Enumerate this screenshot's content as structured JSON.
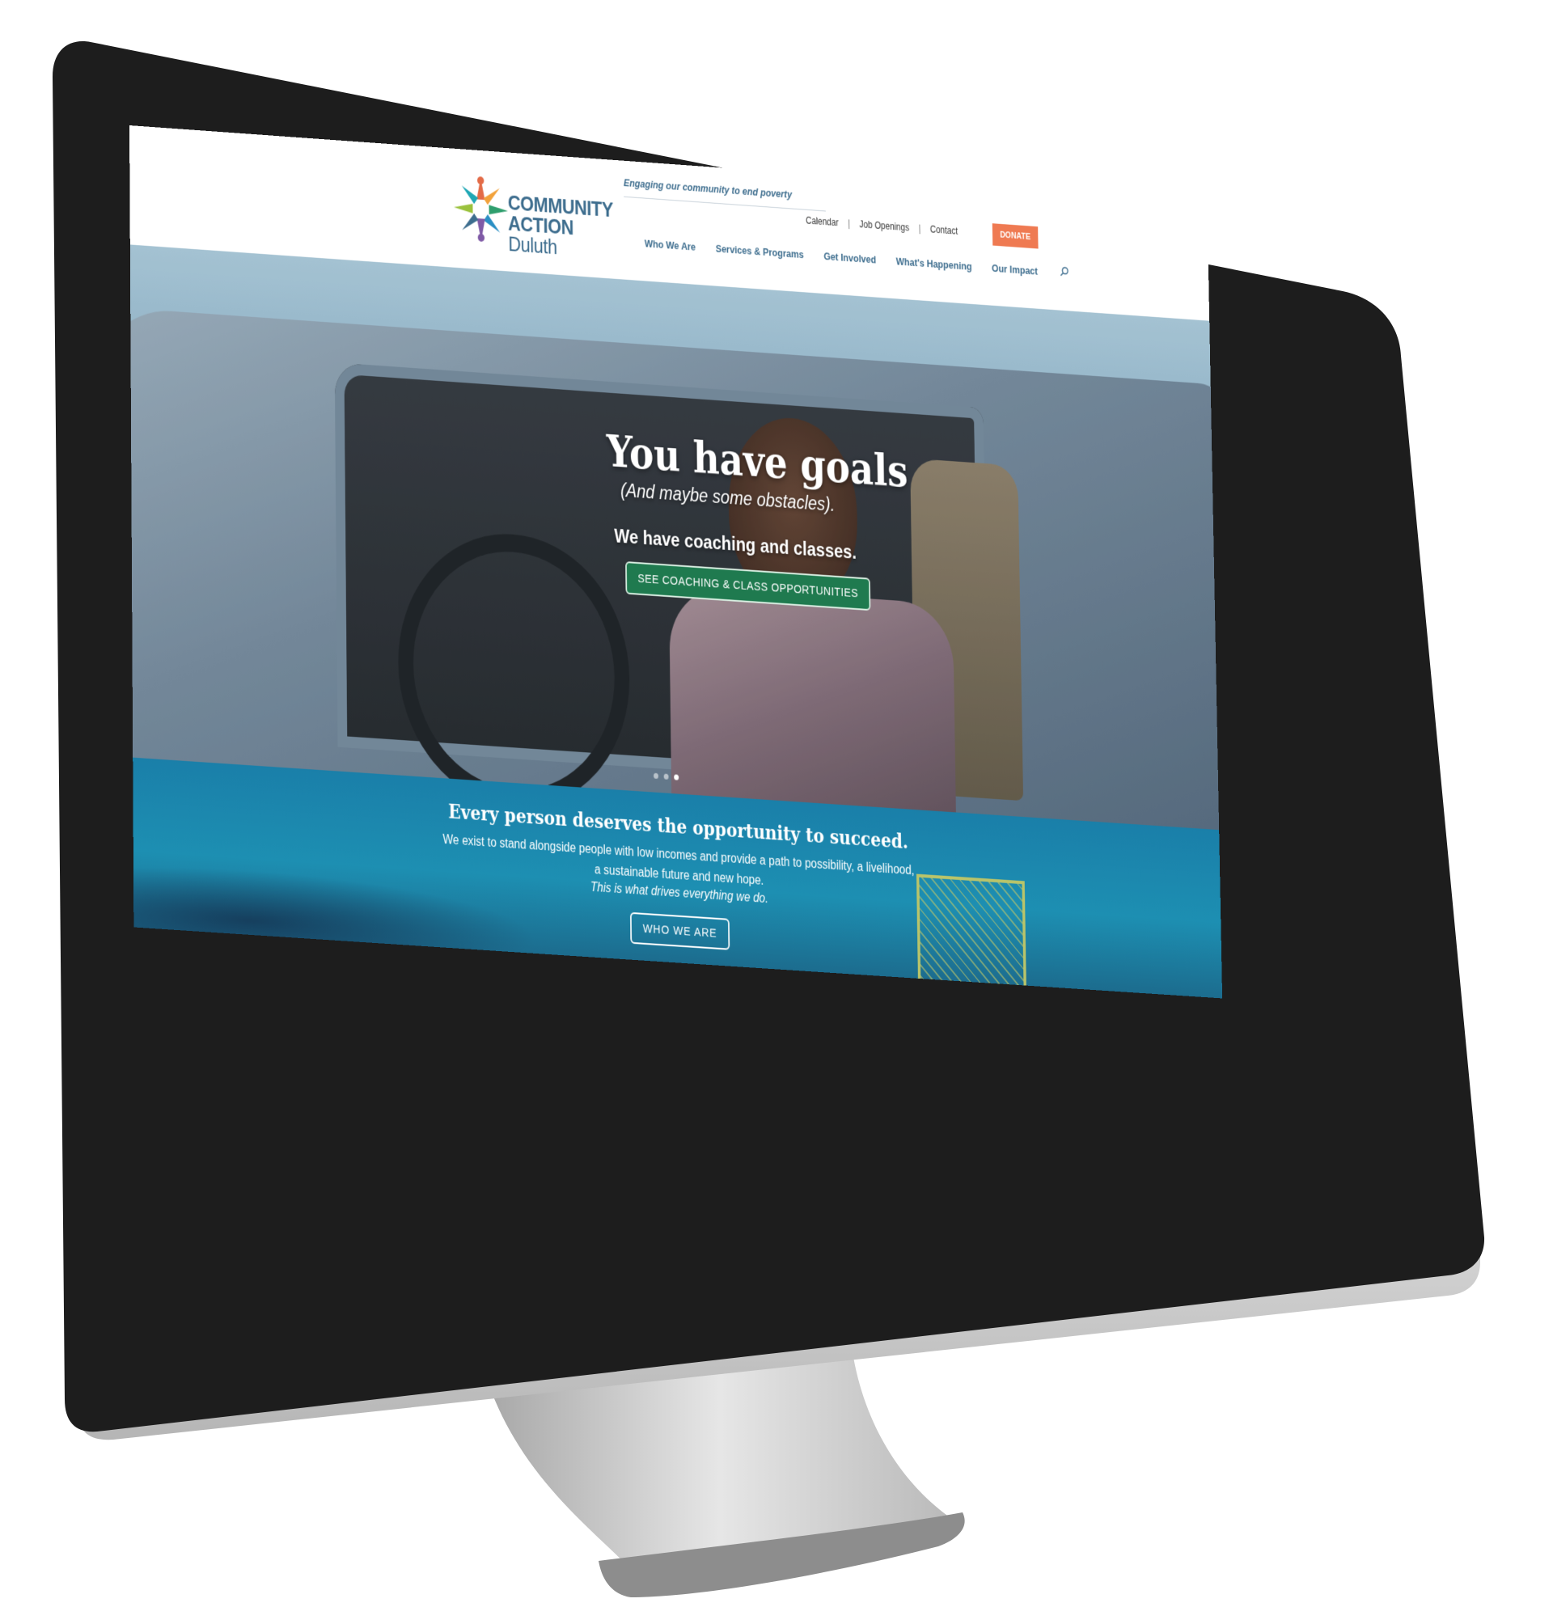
{
  "header": {
    "logo_line1": "COMMUNITY",
    "logo_line2_strong": "ACTION",
    "logo_line2_rest": "Duluth",
    "tagline": "Engaging our community to end poverty",
    "top_links": [
      "Calendar",
      "Job Openings",
      "Contact"
    ],
    "donate_label": "DONATE",
    "nav": [
      "Who We Are",
      "Services & Programs",
      "Get Involved",
      "What's Happening",
      "Our Impact"
    ],
    "search_icon": "search-icon"
  },
  "hero": {
    "title": "You have goals",
    "subtitle": "(And maybe some obstacles).",
    "subtitle2": "We have coaching and classes.",
    "cta": "SEE COACHING & CLASS OPPORTUNITIES",
    "slider": {
      "count": 3,
      "active": 3
    }
  },
  "mission": {
    "title": "Every person deserves the opportunity to succeed.",
    "body": "We exist to stand alongside people with low incomes and provide a path to possibility, a livelihood, a sustainable future and new hope.",
    "italic": "This is what drives everything we do.",
    "button": "WHO WE ARE"
  },
  "colors": {
    "brand_blue": "#3d6d8e",
    "donate": "#ef7a52",
    "cta_green": "#1f7a4f",
    "mission_bg": "#1a7fa9"
  }
}
